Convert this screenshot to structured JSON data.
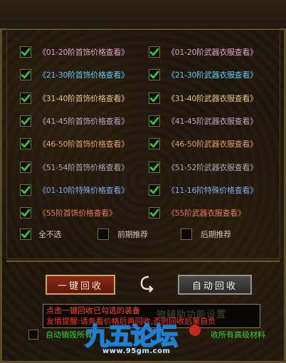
{
  "options": [
    {
      "label": "《01-20阶首饰价格查看》",
      "color": "#e0a2c8",
      "checked": true
    },
    {
      "label": "《01-20阶武器衣服查看》",
      "color": "#e0a2c8",
      "checked": true
    },
    {
      "label": "《21-30阶首饰价格查看》",
      "color": "#63c7ee",
      "checked": true
    },
    {
      "label": "《21-30阶武器衣服查看》",
      "color": "#63c7ee",
      "checked": true
    },
    {
      "label": "《31-40阶首饰价格查看》",
      "color": "#e6c28a",
      "checked": true
    },
    {
      "label": "《31-40阶武器衣服查看》",
      "color": "#e6c28a",
      "checked": true
    },
    {
      "label": "《41-45阶首饰价格查看》",
      "color": "#b5a8c2",
      "checked": true
    },
    {
      "label": "《41-45阶武器衣服查看》",
      "color": "#b5a8c2",
      "checked": true
    },
    {
      "label": "《46-50阶首饰价格查看》",
      "color": "#e89a70",
      "checked": true
    },
    {
      "label": "《46-50阶武器衣服查看》",
      "color": "#e89a70",
      "checked": true
    },
    {
      "label": "《51-54阶首饰价格查看》",
      "color": "#a9a9a9",
      "checked": true
    },
    {
      "label": "《51-52阶武器衣服查看》",
      "color": "#a9a9a9",
      "checked": true
    },
    {
      "label": "《01-10阶特殊价格查看》",
      "color": "#7fa7f0",
      "checked": true
    },
    {
      "label": "《11-16阶特殊价格查看》",
      "color": "#7fa7f0",
      "checked": true
    },
    {
      "label": "《55阶首饰价格查看》",
      "color": "#e37a5c",
      "checked": true
    },
    {
      "label": "《55阶武器衣服查看》",
      "color": "#e37a5c",
      "checked": true
    }
  ],
  "select_row": [
    {
      "label": "全不选",
      "checked": true
    },
    {
      "label": "前期推荐",
      "checked": false
    },
    {
      "label": "后期推荐",
      "checked": false
    }
  ],
  "buttons": {
    "recycle_one_click": "一键回收",
    "auto_recycle": "自动回收",
    "swap_icon": "swap-arrows-icon"
  },
  "tooltip": {
    "line1": "点击一键回收已勾选的装备",
    "line2": "友情提醒:请务看价格后再回收,否则回收后果自负",
    "ghost_text": "物辅助功能设置"
  },
  "bottom": {
    "auto_destroy_label": "自动销毁所有",
    "auto_recycle_advanced_label": "收所有高级材料",
    "auto_destroy_checked": false
  },
  "watermark": {
    "logo_text": "九五论坛",
    "url": "www.95gm.com"
  },
  "colors": {
    "check_green": "#35c535",
    "frame_border": "#6b5730"
  }
}
